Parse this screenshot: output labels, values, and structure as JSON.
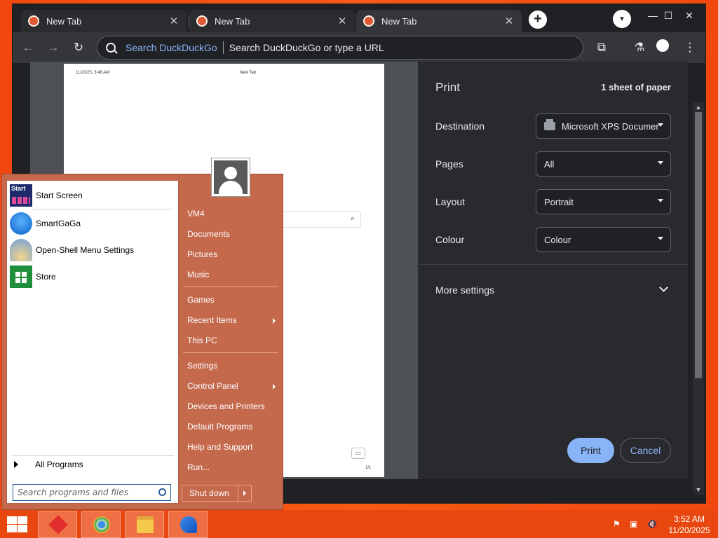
{
  "browser": {
    "tabs": [
      {
        "title": "New Tab",
        "close": "✕"
      },
      {
        "title": "New Tab",
        "close": "✕"
      },
      {
        "title": "New Tab",
        "close": "✕"
      }
    ],
    "new_tab_symbol": "+",
    "window_controls": {
      "minimize": "—",
      "maximize": "☐",
      "close": "✕"
    },
    "toolbar": {
      "back_icon": "←",
      "forward_icon": "→",
      "reload_icon": "↻",
      "omnibox_engine": "Search DuckDuckGo",
      "omnibox_placeholder": "Search DuckDuckGo or type a URL",
      "extensions_icon": "puzzle-icon",
      "labs_icon": "flask-icon",
      "menu_icon": "⋮"
    }
  },
  "print_preview": {
    "page_header_date": "11/20/25, 3:48 AM",
    "page_header_title": "New Tab",
    "page_number": "1/1"
  },
  "print_settings": {
    "title": "Print",
    "sheets": "1 sheet of paper",
    "rows": [
      {
        "label": "Destination",
        "value": "Microsoft XPS Documer"
      },
      {
        "label": "Pages",
        "value": "All"
      },
      {
        "label": "Layout",
        "value": "Portrait"
      },
      {
        "label": "Colour",
        "value": "Colour"
      }
    ],
    "more_settings": "More settings",
    "print_button": "Print",
    "cancel_button": "Cancel"
  },
  "start_menu": {
    "pinned": [
      {
        "label": "Start Screen",
        "icon": "start-screen-icon"
      },
      {
        "label": "SmartGaGa",
        "icon": "swan-icon"
      },
      {
        "label": "Open-Shell Menu Settings",
        "icon": "shell-icon"
      },
      {
        "label": "Store",
        "icon": "store-icon"
      }
    ],
    "all_programs": "All Programs",
    "search_placeholder": "Search programs and files",
    "right_items": [
      {
        "label": "VM4",
        "submenu": false
      },
      {
        "label": "Documents",
        "submenu": false
      },
      {
        "label": "Pictures",
        "submenu": false
      },
      {
        "label": "Music",
        "submenu": false
      },
      {
        "label": "Games",
        "submenu": false
      },
      {
        "label": "Recent Items",
        "submenu": true
      },
      {
        "label": "This PC",
        "submenu": false
      },
      {
        "label": "Settings",
        "submenu": false
      },
      {
        "label": "Control Panel",
        "submenu": true
      },
      {
        "label": "Devices and Printers",
        "submenu": false
      },
      {
        "label": "Default Programs",
        "submenu": false
      },
      {
        "label": "Help and Support",
        "submenu": false
      },
      {
        "label": "Run...",
        "submenu": false
      }
    ],
    "shutdown": "Shut down"
  },
  "taskbar": {
    "pinned_icons": [
      "app-red-icon",
      "chrome-icon",
      "file-explorer-icon",
      "smartgaga-icon"
    ],
    "tray_icons": [
      "flag-icon",
      "network-icon",
      "volume-muted-icon"
    ],
    "time": "3:52 AM",
    "date": "11/20/2025"
  }
}
